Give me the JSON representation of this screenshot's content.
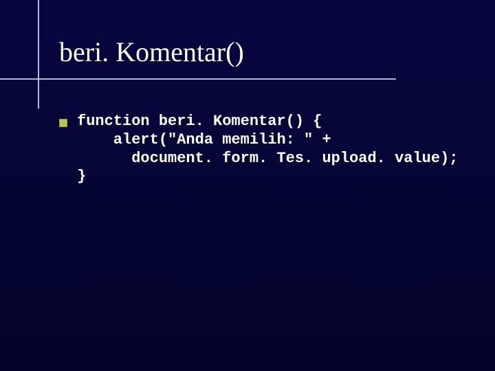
{
  "slide": {
    "title": "beri. Komentar()",
    "code": {
      "l1": "function beri. Komentar() {",
      "l2": "    alert(\"Anda memilih: \" +",
      "l3": "      document. form. Tes. upload. value);",
      "l4": "}"
    }
  }
}
